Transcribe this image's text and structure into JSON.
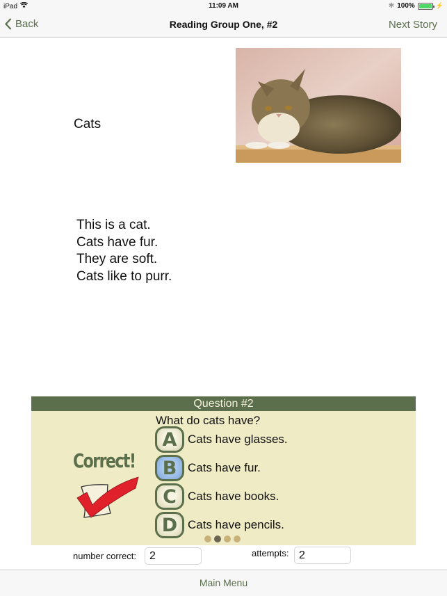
{
  "status_bar": {
    "device": "iPad",
    "time": "11:09 AM",
    "battery_percent": "100%",
    "battery_level": 1.0
  },
  "nav": {
    "back_label": "Back",
    "title": "Reading Group One, #2",
    "next_label": "Next Story"
  },
  "story": {
    "title": "Cats",
    "image_alt": "tabby cat lying on a wooden board",
    "lines": [
      "This is a cat.",
      "Cats have fur.",
      "They are soft.",
      "Cats like to purr."
    ]
  },
  "quiz": {
    "header": "Question #2",
    "question": "What do cats have?",
    "feedback": "Correct!",
    "answers": [
      {
        "letter": "A",
        "text": "Cats have glasses.",
        "selected": false
      },
      {
        "letter": "B",
        "text": "Cats have fur.",
        "selected": true
      },
      {
        "letter": "C",
        "text": "Cats have books.",
        "selected": false
      },
      {
        "letter": "D",
        "text": "Cats have pencils.",
        "selected": false
      }
    ],
    "page_count": 4,
    "current_page": 2
  },
  "score": {
    "correct_label": "number correct:",
    "correct_value": "2",
    "attempts_label": "attempts:",
    "attempts_value": "2"
  },
  "bottom": {
    "main_menu_label": "Main Menu"
  },
  "colors": {
    "accent_green": "#5b6f4d",
    "quiz_background": "#efebc5",
    "selected_blue": "#7ea6d8",
    "check_red": "#e0202a",
    "battery_green": "#4cd964"
  }
}
